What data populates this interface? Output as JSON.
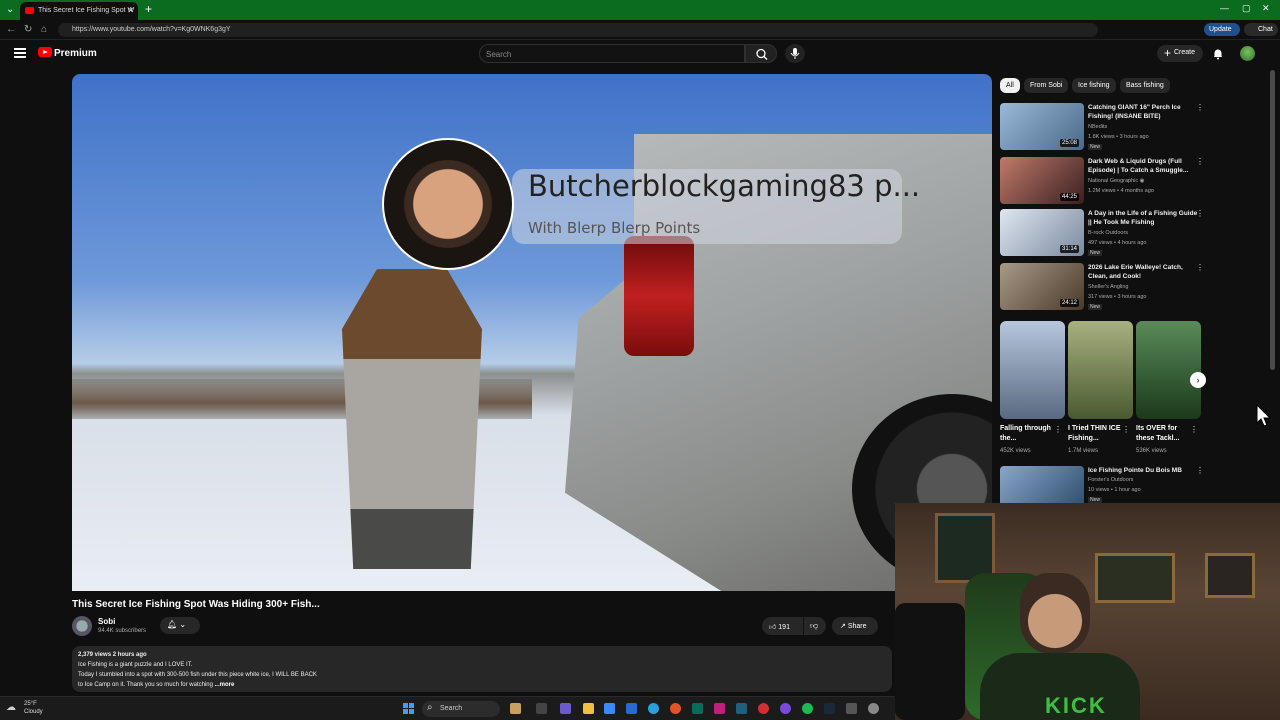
{
  "browser": {
    "tab_title": "This Secret Ice Fishing Spot W",
    "url": "https://www.youtube.com/watch?v=Kg0WNK6g3gY",
    "update_label": "Update",
    "chat_label": "Chat"
  },
  "header": {
    "logo_text": "Premium",
    "search_placeholder": "Search",
    "create_label": "Create"
  },
  "video": {
    "overlay_title": "Butcherblockgaming83 p...",
    "overlay_subtitle": "With Blerp Blerp Points",
    "title": "This Secret Ice Fishing Spot Was Hiding 300+ Fish...",
    "channel": "Sobi",
    "subscribers": "94.4K subscribers",
    "likes": "191",
    "share_label": "Share",
    "description": {
      "meta": "2,379 views  2 hours ago",
      "line1": "Ice Fishing is a giant puzzle and I LOVE IT.",
      "line2": "Today I stumbled into a spot with 300-500 fish under this piece white ice, I WILL BE BACK",
      "line3": "to Ice Camp on it. Thank you so much for watching",
      "more": "...more"
    }
  },
  "chips": [
    "All",
    "From Sobi",
    "Ice fishing",
    "Bass fishing"
  ],
  "recommendations": [
    {
      "title": "Catching GIANT 16\" Perch Ice Fishing! (INSANE BITE)",
      "channel": "NBedits",
      "stats": "1.8K views • 3 hours ago",
      "badge": "New",
      "duration": "25:08",
      "color": "#6a8fb0"
    },
    {
      "title": "Dark Web & Liquid Drugs (Full Episode) | To Catch a Smuggle...",
      "channel": "National Geographic ◉",
      "stats": "1.2M views • 4 months ago",
      "badge": "",
      "duration": "44:25",
      "color": "#8a4a4a"
    },
    {
      "title": "A Day in the Life of a Fishing Guide || He Took Me Fishing",
      "channel": "B-rock Outdoors",
      "stats": "497 views • 4 hours ago",
      "badge": "New",
      "duration": "31:14",
      "color": "#c0c8d8"
    },
    {
      "title": "2026 Lake Erie Walleye! Catch, Clean, and Cook!",
      "channel": "Sheller's Angling",
      "stats": "317 views • 3 hours ago",
      "badge": "New",
      "duration": "24:12",
      "color": "#7a6a58"
    }
  ],
  "shorts": [
    {
      "title": "Falling through the...",
      "views": "452K views",
      "color": "#7d8fa8"
    },
    {
      "title": "I Tried THIN ICE Fishing...",
      "views": "1.7M views",
      "color": "#6f7a50"
    },
    {
      "title": "Its OVER for these Tackl...",
      "views": "536K views",
      "color": "#3a5a3a"
    }
  ],
  "recommendation5": {
    "title": "Ice Fishing Pointe Du Bois MB",
    "channel": "Forster's Outdoors",
    "stats": "10 views • 1 hour ago",
    "badge": "New",
    "color": "#4a6a8a"
  },
  "webcam": {
    "shirt_text": "KICK"
  },
  "taskbar": {
    "temperature": "25°F",
    "weather": "Cloudy",
    "search_label": "Search"
  }
}
